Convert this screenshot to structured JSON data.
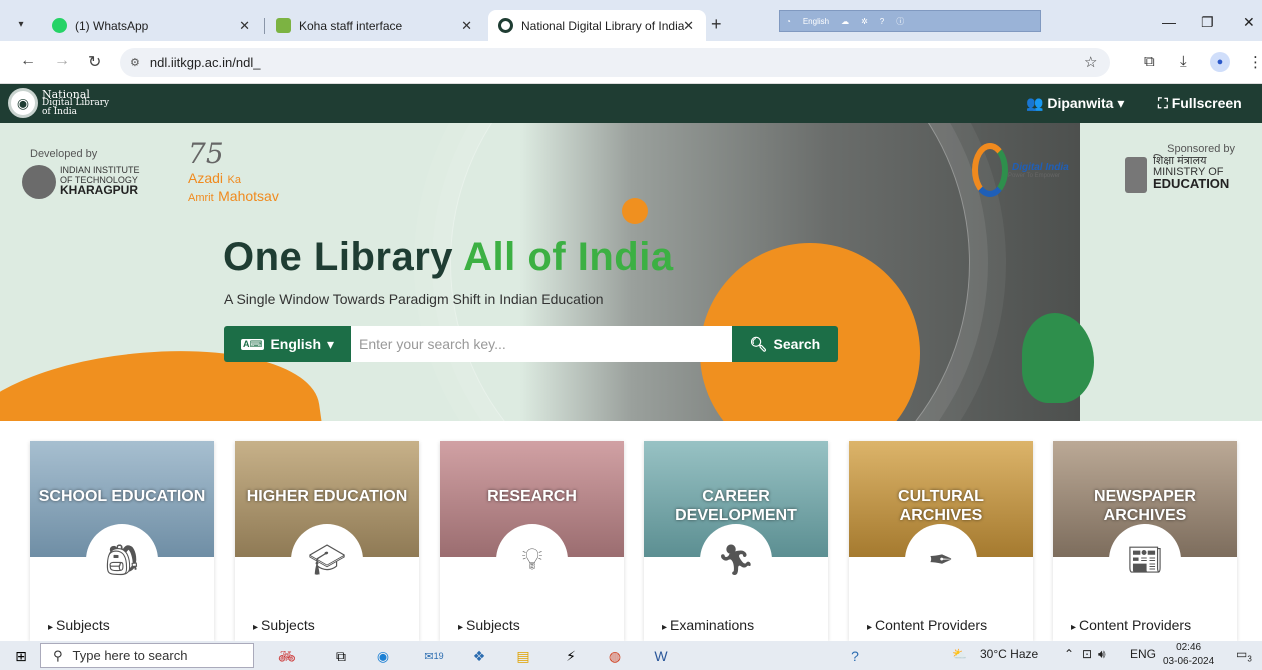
{
  "browser": {
    "tabs": [
      {
        "title": "(1) WhatsApp",
        "active": false,
        "favicon_color": "#25d366"
      },
      {
        "title": "Koha staff interface",
        "active": false,
        "favicon_color": "#7cb342"
      },
      {
        "title": "National Digital Library of India",
        "active": true,
        "favicon_color": "#1f3d33"
      }
    ],
    "url": "ndl.iitkgp.ac.in/ndl_",
    "language_bar": "English"
  },
  "header": {
    "logo_line1": "National",
    "logo_line2": "Digital Library",
    "logo_line3": "of India",
    "user": "Dipanwita",
    "fullscreen": "Fullscreen"
  },
  "hero": {
    "developed_by": "Developed by",
    "iit_line1": "INDIAN INSTITUTE",
    "iit_line2": "OF TECHNOLOGY",
    "iit_line3": "KHARAGPUR",
    "azadi_75": "75",
    "azadi_line1": "Azadi",
    "azadi_ka": "Ka",
    "azadi_line2": "Amrit",
    "azadi_mahotsav": "Mahotsav",
    "digital_india": "Digital India",
    "digital_india_sub": "Power To Empower",
    "sponsored_by": "Sponsored by",
    "ministry_hindi": "शिक्षा मंत्रालय",
    "ministry_line1": "MINISTRY OF",
    "ministry_line2": "EDUCATION",
    "title_part1": "One Library",
    "title_part2": "All of India",
    "subtitle": "A Single Window Towards Paradigm Shift in Indian Education",
    "language": "English",
    "search_placeholder": "Enter your search key...",
    "search_button": "Search"
  },
  "cards": [
    {
      "title": "SCHOOL EDUCATION",
      "link": "Subjects",
      "icon": "backpack-icon",
      "color": "#7b9bb3"
    },
    {
      "title": "HIGHER EDUCATION",
      "link": "Subjects",
      "icon": "graduate-icon",
      "color": "#a88f63"
    },
    {
      "title": "RESEARCH",
      "link": "Subjects",
      "icon": "lightbulb-icon",
      "color": "#b47f82"
    },
    {
      "title": "CAREER DEVELOPMENT",
      "link": "Examinations",
      "icon": "runner-icon",
      "color": "#6fa3a6"
    },
    {
      "title": "CULTURAL ARCHIVES",
      "link": "Content Providers",
      "icon": "quill-icon",
      "color": "#c49b4b"
    },
    {
      "title": "NEWSPAPER ARCHIVES",
      "link": "Content Providers",
      "icon": "newspaper-icon",
      "color": "#9b8a7a"
    }
  ],
  "taskbar": {
    "search_placeholder": "Type here to search",
    "weather": "30°C Haze",
    "lang": "ENG",
    "time": "02:46",
    "date": "03-06-2024",
    "badge_count": "19",
    "notification_count": "3"
  }
}
